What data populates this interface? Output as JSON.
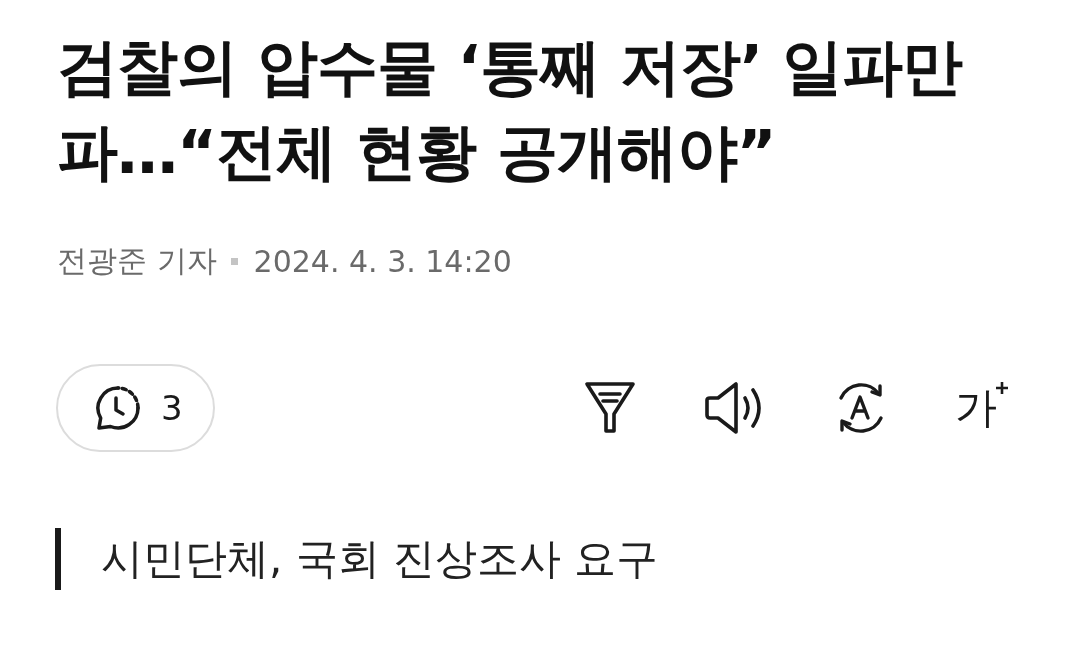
{
  "article": {
    "title": "검찰의 압수물 ‘통째 저장’ 일파만파…“전체 현황 공개해야”",
    "reporter": "전광준 기자",
    "date": "2024. 4. 3. 14:20"
  },
  "toolbar": {
    "comments": {
      "count": "3"
    },
    "tools": [
      {
        "kind": "summary"
      },
      {
        "kind": "listen"
      },
      {
        "kind": "translate"
      },
      {
        "kind": "font-size",
        "label": "가"
      }
    ]
  },
  "subtitle": "시민단체, 국회 진상조사 요구"
}
